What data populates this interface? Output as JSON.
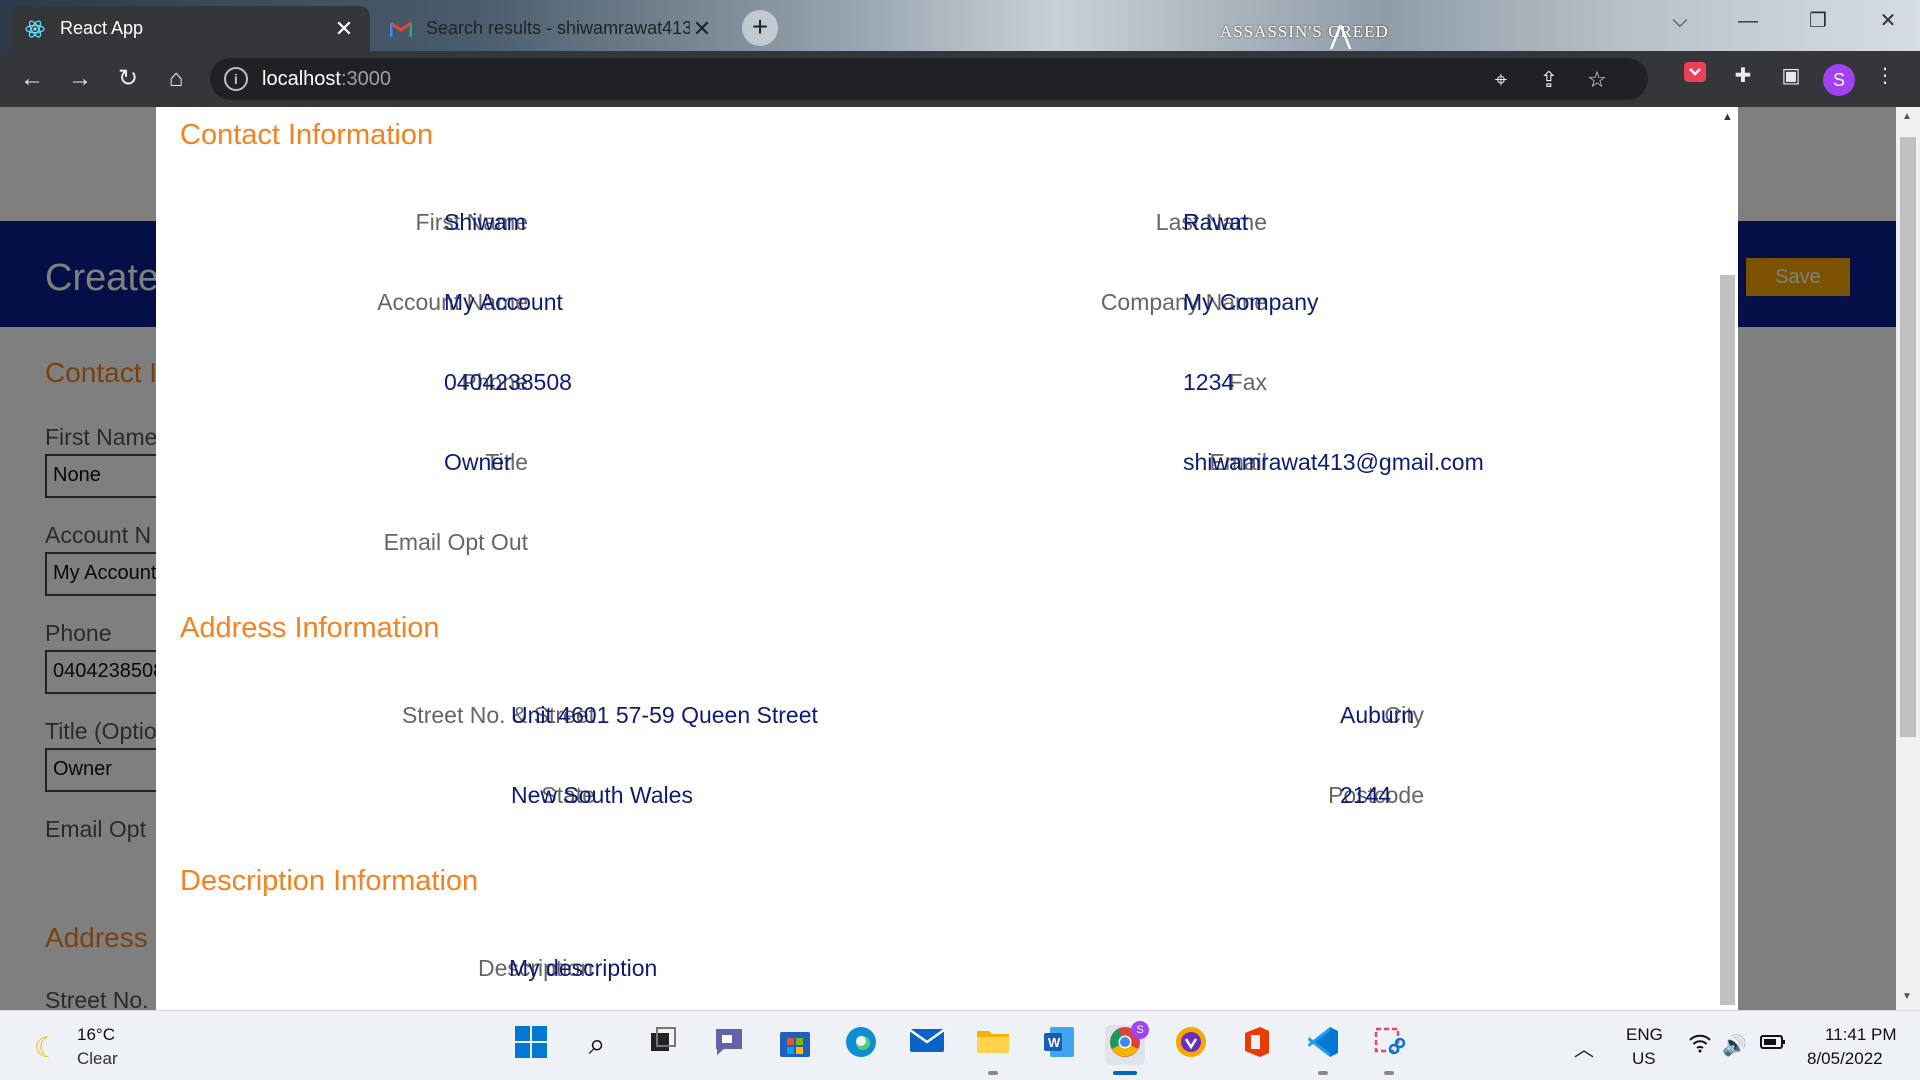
{
  "browser": {
    "tabs": [
      {
        "title": "React App",
        "icon": "react-icon",
        "active": true
      },
      {
        "title": "Search results - shiwamrawat413",
        "icon": "gmail-icon",
        "active": false
      }
    ],
    "theme_logo": "ASSASSIN'S CREED",
    "url_host": "localhost",
    "url_port": ":3000",
    "profile_initial": "S"
  },
  "background_page": {
    "header_title": "Create",
    "save_label": "Save",
    "section_contact": "Contact I",
    "label_first_name": "First Name",
    "input_first_name": "None",
    "label_account": "Account N",
    "input_account": "My Account",
    "label_phone": "Phone",
    "input_phone": "0404238508",
    "label_title": "Title (Optio",
    "input_title": "Owner",
    "label_email_opt": "Email Opt",
    "section_address": "Address I",
    "label_street": "Street No."
  },
  "modal": {
    "contact": {
      "title": "Contact Information",
      "fields": [
        {
          "label": "First Name",
          "value": "Shiwam"
        },
        {
          "label": "Last Name",
          "value": "Rawat"
        },
        {
          "label": "Account Name",
          "value": "My Account"
        },
        {
          "label": "Company Name",
          "value": "My Company"
        },
        {
          "label": "Phone",
          "value": "0404238508"
        },
        {
          "label": "Fax",
          "value": "1234"
        },
        {
          "label": "Title",
          "value": "Owner"
        },
        {
          "label": "Email",
          "value": "shiwamrawat413@gmail.com"
        },
        {
          "label": "Email Opt Out",
          "value": ""
        }
      ]
    },
    "address": {
      "title": "Address Information",
      "fields": [
        {
          "label": "Street No. & Street",
          "value": "Unit 4601 57-59 Queen Street"
        },
        {
          "label": "City",
          "value": "Auburn"
        },
        {
          "label": "State",
          "value": "New South Wales"
        },
        {
          "label": "Postcode",
          "value": "2144"
        }
      ]
    },
    "description": {
      "title": "Description Information",
      "fields": [
        {
          "label": "Description",
          "value": "My description"
        }
      ]
    }
  },
  "taskbar": {
    "weather_temp": "16°C",
    "weather_condition": "Clear",
    "lang_line1": "ENG",
    "lang_line2": "US",
    "time": "11:41 PM",
    "date": "8/05/2022",
    "chrome_badge": "S"
  },
  "colors": {
    "section_orange": "#f58220",
    "value_navy": "#0f1a7a",
    "header_blue": "#0a1f8f",
    "save_amber": "#f6a700"
  }
}
